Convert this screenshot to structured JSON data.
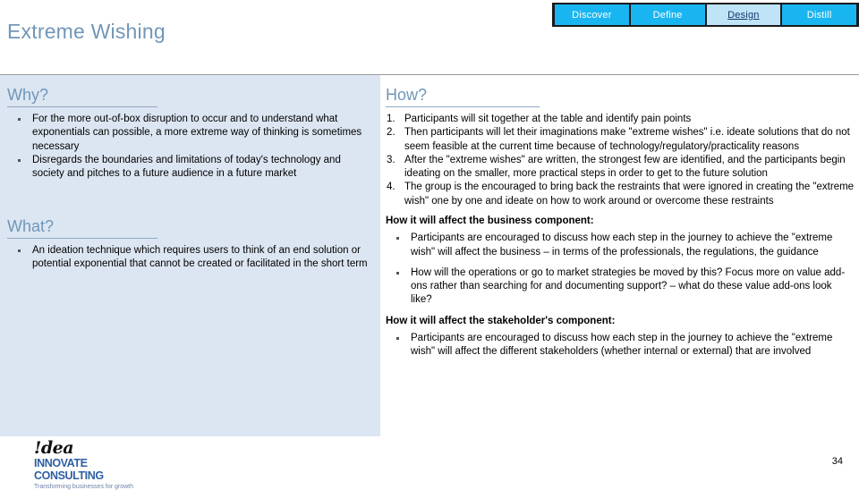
{
  "slide": {
    "title": "Extreme Wishing",
    "page_number": "34"
  },
  "nav": {
    "tabs": [
      {
        "label": "Discover",
        "active": false
      },
      {
        "label": "Define",
        "active": false
      },
      {
        "label": "Design",
        "active": true
      },
      {
        "label": "Distill",
        "active": false
      }
    ],
    "colors": {
      "tab_background": "#19B5F0",
      "tab_text": "#ffffff",
      "active_background": "#BFE4F7",
      "active_text": "#123A6B",
      "bar_background": "#1a1a1a"
    }
  },
  "why": {
    "heading": "Why?",
    "bullets": [
      "For the more out-of-box disruption to occur and to understand what exponentials can possible, a more extreme way of thinking is sometimes necessary",
      "Disregards the boundaries and limitations of today's technology and society and pitches to a future audience in a future market"
    ]
  },
  "what": {
    "heading": "What?",
    "bullets": [
      "An ideation technique which requires users to think of an end solution or potential exponential that cannot be created or facilitated in the short term"
    ]
  },
  "how": {
    "heading": "How?",
    "steps": [
      "Participants will sit together at the table and identify pain points",
      "Then participants will let their imaginations make \"extreme wishes\" i.e. ideate solutions that do not seem feasible at the current time because of technology/regulatory/practicality reasons",
      "After the \"extreme wishes\" are written, the strongest few are identified, and the participants begin ideating on the smaller, more practical steps in order to get to the future solution",
      "The group is the encouraged to bring back the restraints that were ignored in creating the \"extreme wish\" one by one and ideate on how to work around or overcome these restraints"
    ],
    "business": {
      "heading": "How it will affect the business component:",
      "bullets": [
        "Participants are encouraged to discuss how each step in the journey to achieve the \"extreme wish\" will affect the business – in terms of the professionals, the regulations, the guidance",
        "How will the operations or go to market strategies be moved by this? Focus more on value add-ons rather than searching for and documenting support? – what do these value add-ons look like?"
      ]
    },
    "stakeholder": {
      "heading": "How it will affect the stakeholder's component:",
      "bullets": [
        "Participants are encouraged to discuss how each step in the journey to achieve the \"extreme wish\" will affect the different stakeholders (whether internal or external) that are involved"
      ]
    }
  },
  "logo": {
    "mark": "!dea",
    "name": "INNOVATE CONSULTING",
    "tagline": "Transforming businesses for growth"
  },
  "theme": {
    "panel_background": "#DCE6F2",
    "heading_color": "#7296B8",
    "rule_color": "#8EA9C4"
  }
}
